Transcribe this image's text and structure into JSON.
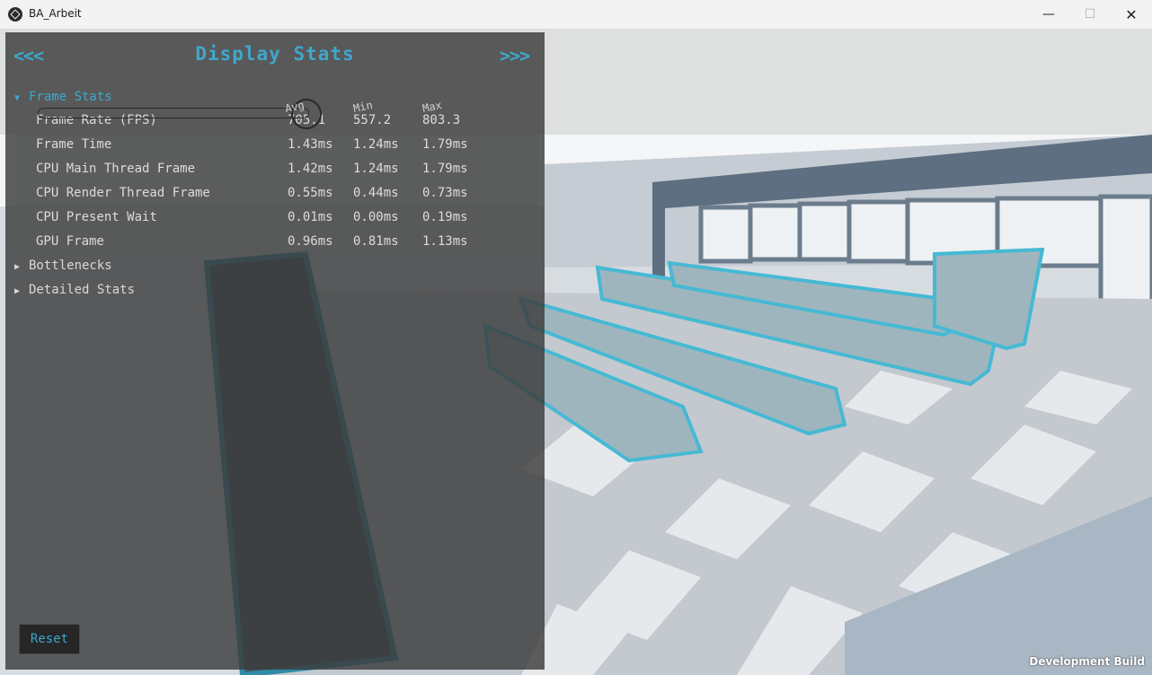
{
  "window": {
    "title": "BA_Arbeit",
    "minimize": "—",
    "maximize": "☐",
    "close": "✕"
  },
  "panel": {
    "title": "Display Stats",
    "prev": "<<<",
    "next": ">>>",
    "columns": {
      "avg": "Avg",
      "min": "Min",
      "max": "Max"
    },
    "sections": {
      "frame_stats": "Frame Stats",
      "bottlenecks": "Bottlenecks",
      "detailed_stats": "Detailed Stats"
    },
    "rows": [
      {
        "label": "Frame Rate (FPS)",
        "avg": "705.1",
        "min": "557.2",
        "max": "803.3"
      },
      {
        "label": "Frame Time",
        "avg": "1.43ms",
        "min": "1.24ms",
        "max": "1.79ms"
      },
      {
        "label": "CPU Main Thread Frame",
        "avg": "1.42ms",
        "min": "1.24ms",
        "max": "1.79ms"
      },
      {
        "label": "CPU Render Thread Frame",
        "avg": "0.55ms",
        "min": "0.44ms",
        "max": "0.73ms"
      },
      {
        "label": "CPU Present Wait",
        "avg": "0.01ms",
        "min": "0.00ms",
        "max": "0.19ms"
      },
      {
        "label": "GPU Frame",
        "avg": "0.96ms",
        "min": "0.81ms",
        "max": "1.13ms"
      }
    ],
    "reset": "Reset"
  },
  "overlay": {
    "dev_build": "Development Build"
  },
  "colors": {
    "accent": "#3fa7cc",
    "shelf": "#46b9d4",
    "panel_bg": "#3c3c3c"
  }
}
